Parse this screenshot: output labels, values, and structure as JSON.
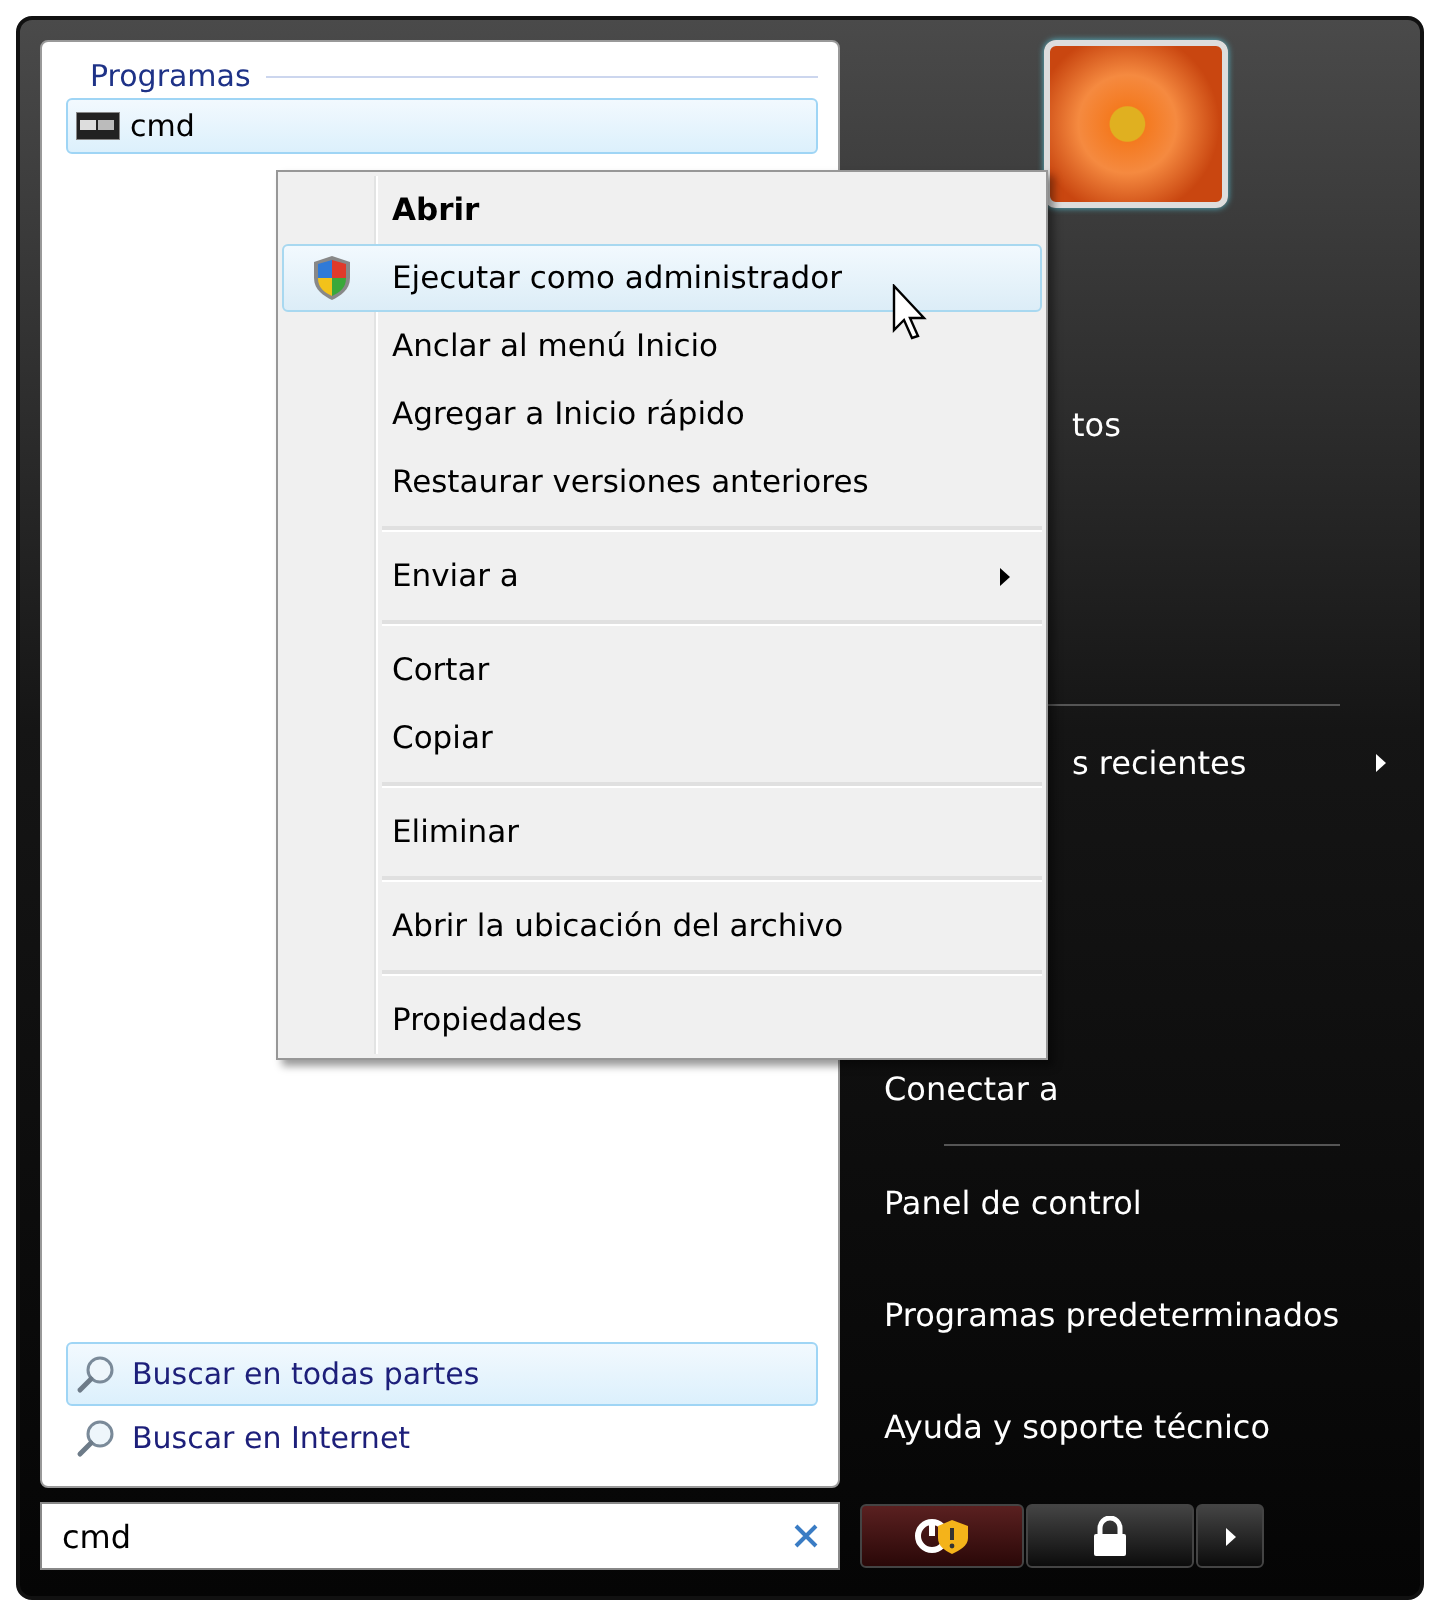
{
  "programs": {
    "heading": "Programas",
    "items": [
      {
        "label": "cmd",
        "selected": true
      }
    ]
  },
  "context_menu": {
    "items": [
      {
        "kind": "item",
        "label": "Abrir",
        "default": true,
        "selected": false,
        "submenu": false
      },
      {
        "kind": "shield_item",
        "label": "Ejecutar como administrador",
        "default": false,
        "selected": true,
        "submenu": false
      },
      {
        "kind": "item",
        "label": "Anclar al menú Inicio",
        "default": false,
        "selected": false,
        "submenu": false
      },
      {
        "kind": "item",
        "label": "Agregar a Inicio rápido",
        "default": false,
        "selected": false,
        "submenu": false
      },
      {
        "kind": "item",
        "label": "Restaurar versiones anteriores",
        "default": false,
        "selected": false,
        "submenu": false
      },
      {
        "kind": "separator"
      },
      {
        "kind": "item",
        "label": "Enviar a",
        "default": false,
        "selected": false,
        "submenu": true
      },
      {
        "kind": "separator"
      },
      {
        "kind": "item",
        "label": "Cortar",
        "default": false,
        "selected": false,
        "submenu": false
      },
      {
        "kind": "item",
        "label": "Copiar",
        "default": false,
        "selected": false,
        "submenu": false
      },
      {
        "kind": "separator"
      },
      {
        "kind": "item",
        "label": "Eliminar",
        "default": false,
        "selected": false,
        "submenu": false
      },
      {
        "kind": "separator"
      },
      {
        "kind": "item",
        "label": "Abrir la ubicación del archivo",
        "default": false,
        "selected": false,
        "submenu": false
      },
      {
        "kind": "separator"
      },
      {
        "kind": "item",
        "label": "Propiedades",
        "default": false,
        "selected": false,
        "submenu": false
      }
    ]
  },
  "search_links": [
    {
      "label": "Buscar en todas partes",
      "selected": true
    },
    {
      "label": "Buscar en Internet",
      "selected": false
    }
  ],
  "search_field": {
    "value": "cmd"
  },
  "right_panel": {
    "top": [
      {
        "kind": "partial",
        "label": "tos",
        "submenu": false
      },
      {
        "kind": "separator"
      },
      {
        "kind": "partial",
        "label": "s recientes",
        "submenu": true
      }
    ],
    "bottom": [
      {
        "kind": "item",
        "label": "Conectar a",
        "submenu": false
      },
      {
        "kind": "separator"
      },
      {
        "kind": "item",
        "label": "Panel de control",
        "submenu": false
      },
      {
        "kind": "item",
        "label": "Programas predeterminados",
        "submenu": false
      },
      {
        "kind": "item",
        "label": "Ayuda y soporte técnico",
        "submenu": false
      }
    ]
  }
}
